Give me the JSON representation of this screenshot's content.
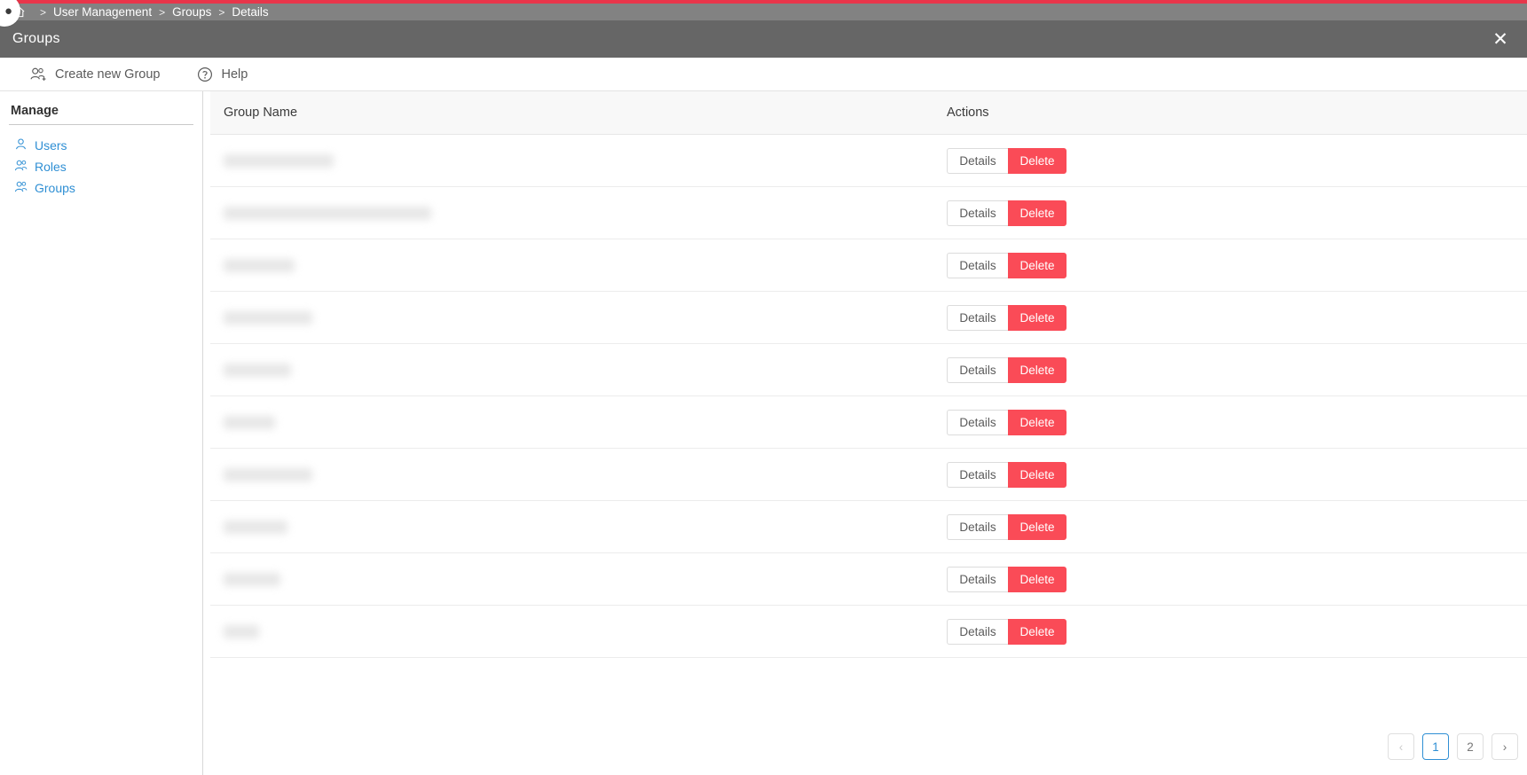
{
  "window": {
    "title": "Groups",
    "close_label": "✕",
    "accent_color": "#e8354a",
    "header_color": "#666666",
    "breadcrumb_bar_color": "#828282"
  },
  "breadcrumb": {
    "home_icon": "home-icon",
    "separator": ">",
    "items": [
      {
        "label": "User Management"
      },
      {
        "label": "Groups"
      },
      {
        "label": "Details"
      }
    ]
  },
  "toolbar": {
    "items": [
      {
        "label": "Create new Group",
        "icon": "add-people-icon"
      },
      {
        "label": "Help",
        "icon": "help-circle-icon"
      }
    ]
  },
  "sidebar": {
    "title": "Manage",
    "items": [
      {
        "label": "Users",
        "icon": "user-icon"
      },
      {
        "label": "Roles",
        "icon": "people-icon"
      },
      {
        "label": "Groups",
        "icon": "people-icon"
      }
    ],
    "link_color": "#2f8fd4"
  },
  "table": {
    "columns": [
      "Group Name",
      "Actions"
    ],
    "action_labels": {
      "details": "Details",
      "delete": "Delete"
    },
    "delete_color": "#fa4b57",
    "rows": [
      {
        "name": "",
        "redacted": true,
        "redacted_width": 124
      },
      {
        "name": "",
        "redacted": true,
        "redacted_width": 234
      },
      {
        "name": "",
        "redacted": true,
        "redacted_width": 80
      },
      {
        "name": "",
        "redacted": true,
        "redacted_width": 100
      },
      {
        "name": "",
        "redacted": true,
        "redacted_width": 76
      },
      {
        "name": "",
        "redacted": true,
        "redacted_width": 58
      },
      {
        "name": "",
        "redacted": true,
        "redacted_width": 100
      },
      {
        "name": "",
        "redacted": true,
        "redacted_width": 72
      },
      {
        "name": "",
        "redacted": true,
        "redacted_width": 64
      },
      {
        "name": "",
        "redacted": true,
        "redacted_width": 40
      }
    ]
  },
  "pagination": {
    "prev": "‹",
    "next": "›",
    "pages": [
      "1",
      "2"
    ],
    "current": "1"
  }
}
